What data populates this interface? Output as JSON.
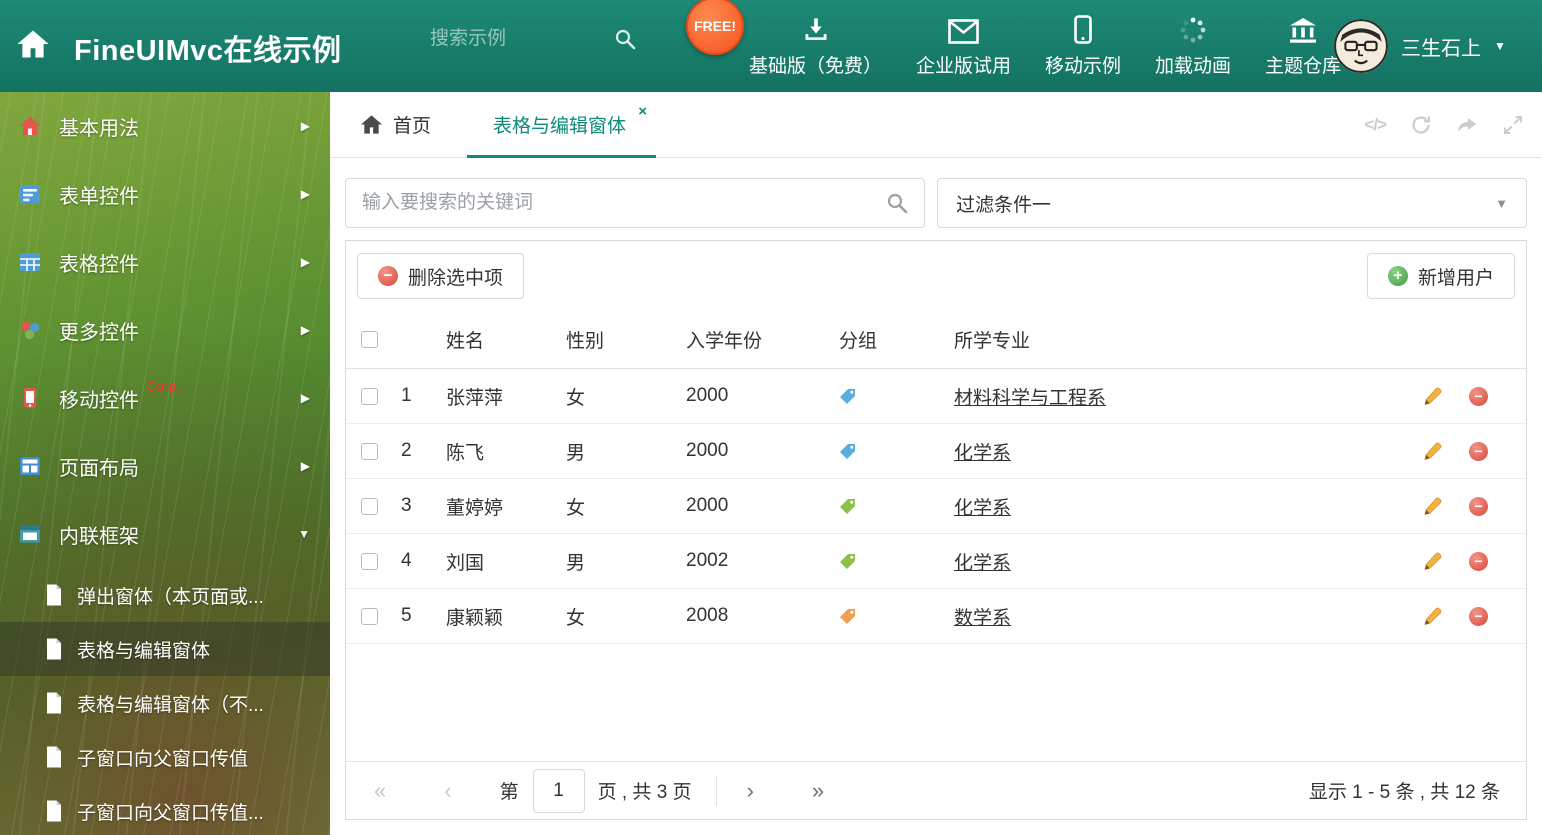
{
  "colors": {
    "accent": "#0f8a78",
    "header_green": "#17816d",
    "link": "#333333"
  },
  "icons": {
    "arrow_right": "▶",
    "arrow_down": "▼",
    "caret_down": "▼",
    "close": "×",
    "code": "</>",
    "first": "«",
    "prev": "‹",
    "next": "›",
    "last": "»"
  },
  "header": {
    "title": "FineUIMvc在线示例",
    "search_placeholder": "搜索示例",
    "free_badge": "FREE!",
    "nav": [
      {
        "label": "基础版（免费）"
      },
      {
        "label": "企业版试用"
      },
      {
        "label": "移动示例"
      },
      {
        "label": "加载动画"
      },
      {
        "label": "主题仓库"
      }
    ],
    "user_name": "三生石上"
  },
  "sidebar": {
    "items": [
      {
        "label": "基本用法"
      },
      {
        "label": "表单控件"
      },
      {
        "label": "表格控件"
      },
      {
        "label": "更多控件"
      },
      {
        "label": "移动控件",
        "badge": "Corp."
      },
      {
        "label": "页面布局"
      },
      {
        "label": "内联框架"
      }
    ],
    "subitems": [
      {
        "label": "弹出窗体（本页面或..."
      },
      {
        "label": "表格与编辑窗体"
      },
      {
        "label": "表格与编辑窗体（不..."
      },
      {
        "label": "子窗口向父窗口传值"
      },
      {
        "label": "子窗口向父窗口传值..."
      }
    ]
  },
  "tabbar": {
    "home_label": "首页",
    "active_label": "表格与编辑窗体"
  },
  "filter": {
    "search_placeholder": "输入要搜索的关键词",
    "selected_filter": "过滤条件一"
  },
  "toolbar": {
    "delete_label": "删除选中项",
    "add_label": "新增用户"
  },
  "table": {
    "columns": [
      "姓名",
      "性别",
      "入学年份",
      "分组",
      "所学专业"
    ],
    "rows": [
      {
        "num": "1",
        "name": "张萍萍",
        "gender": "女",
        "year": "2000",
        "tag_color": "#5aaede",
        "major": "材料科学与工程系"
      },
      {
        "num": "2",
        "name": "陈飞",
        "gender": "男",
        "year": "2000",
        "tag_color": "#5aaede",
        "major": "化学系"
      },
      {
        "num": "3",
        "name": "董婷婷",
        "gender": "女",
        "year": "2000",
        "tag_color": "#8bc34a",
        "major": "化学系"
      },
      {
        "num": "4",
        "name": "刘国",
        "gender": "男",
        "year": "2002",
        "tag_color": "#8bc34a",
        "major": "化学系"
      },
      {
        "num": "5",
        "name": "康颖颖",
        "gender": "女",
        "year": "2008",
        "tag_color": "#f0a050",
        "major": "数学系"
      }
    ]
  },
  "pagination": {
    "prefix": "第",
    "page": "1",
    "info": "页 , 共 3 页",
    "summary": "显示 1 - 5 条 , 共 12 条"
  }
}
